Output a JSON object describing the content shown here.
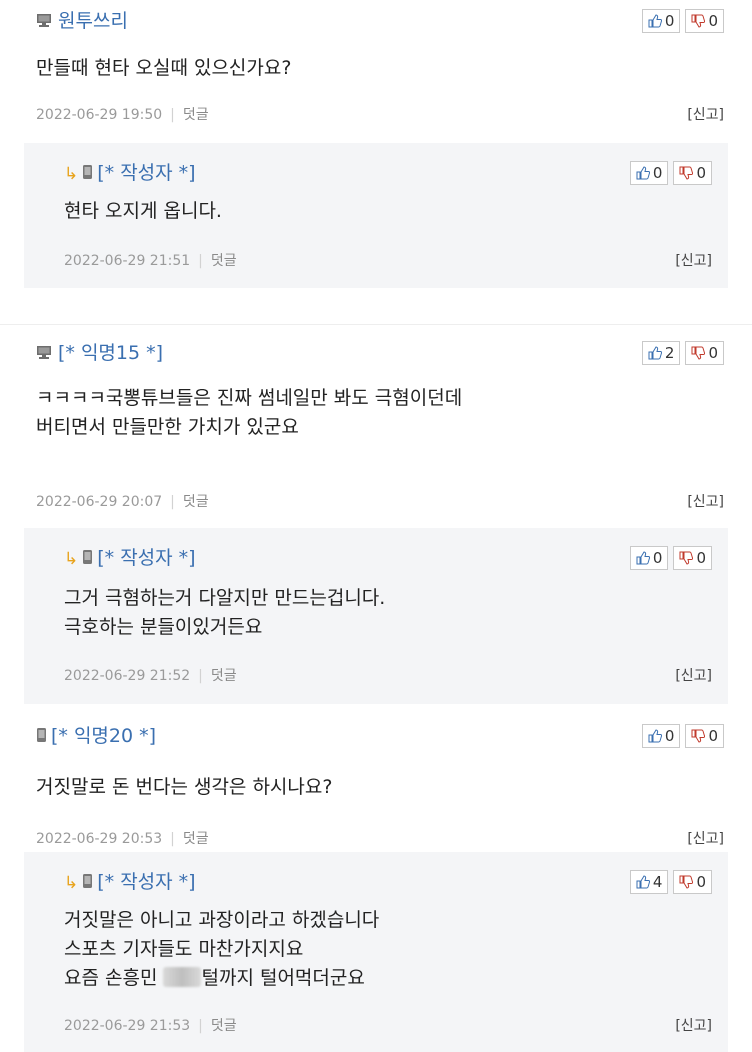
{
  "comments": [
    {
      "author": "원투쓰리",
      "device": "pc",
      "up": "0",
      "down": "0",
      "lines": [
        "만들때 현타 오실때 있으신가요?"
      ],
      "date": "2022-06-29 19:50",
      "reply_label": "덧글",
      "report_label": "[신고]",
      "reply": {
        "author": "[* 작성자 *]",
        "up": "0",
        "down": "0",
        "lines": [
          "현타 오지게 옵니다."
        ],
        "date": "2022-06-29 21:51",
        "reply_label": "덧글",
        "report_label": "[신고]"
      }
    },
    {
      "author": "[* 익명15 *]",
      "device": "pc",
      "up": "2",
      "down": "0",
      "lines": [
        "ㅋㅋㅋㅋ국뽕튜브들은 진짜 썸네일만 봐도 극혐이던데",
        "버티면서 만들만한 가치가 있군요"
      ],
      "date": "2022-06-29 20:07",
      "reply_label": "덧글",
      "report_label": "[신고]",
      "reply": {
        "author": "[* 작성자 *]",
        "up": "0",
        "down": "0",
        "lines": [
          "그거 극혐하는거 다알지만 만드는겁니다.",
          "극호하는 분들이있거든요"
        ],
        "date": "2022-06-29 21:52",
        "reply_label": "덧글",
        "report_label": "[신고]"
      }
    },
    {
      "author": "[* 익명20 *]",
      "device": "mobile",
      "up": "0",
      "down": "0",
      "lines": [
        "거짓말로 돈 번다는 생각은 하시나요?"
      ],
      "date": "2022-06-29 20:53",
      "reply_label": "덧글",
      "report_label": "[신고]",
      "reply": {
        "author": "[* 작성자 *]",
        "up": "4",
        "down": "0",
        "lines": [
          "거짓말은 아니고 과장이라고 하겠습니다",
          "스포츠 기자들도 마찬가지지요"
        ],
        "line3_before": "요즘 손흥민 ",
        "line3_after": "털까지 털어먹더군요",
        "date": "2022-06-29 21:53",
        "reply_label": "덧글",
        "report_label": "[신고]"
      }
    }
  ]
}
